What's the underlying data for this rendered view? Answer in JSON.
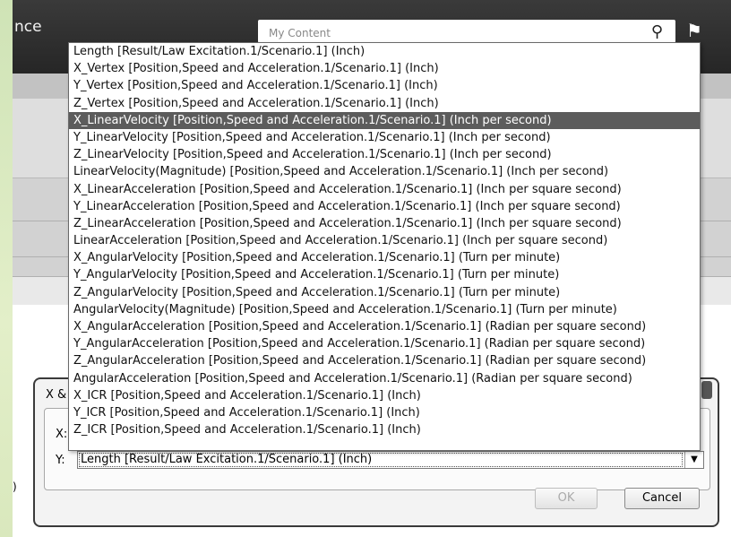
{
  "header": {
    "title_fragment": "nce",
    "search_placeholder": "My Content"
  },
  "dialog": {
    "title_fragment": "X &",
    "x_label": "X:",
    "y_label": "Y:",
    "y_value": "Length [Result/Law Excitation.1/Scenario.1] (Inch)",
    "ok_label": "OK",
    "cancel_label": "Cancel"
  },
  "background": {
    "paren": ")"
  },
  "dropdown": {
    "selected_index": 4,
    "options": [
      "Length [Result/Law Excitation.1/Scenario.1] (Inch)",
      "X_Vertex [Position,Speed and Acceleration.1/Scenario.1] (Inch)",
      "Y_Vertex [Position,Speed and Acceleration.1/Scenario.1] (Inch)",
      "Z_Vertex [Position,Speed and Acceleration.1/Scenario.1] (Inch)",
      "X_LinearVelocity [Position,Speed and Acceleration.1/Scenario.1] (Inch per second)",
      "Y_LinearVelocity [Position,Speed and Acceleration.1/Scenario.1] (Inch per second)",
      "Z_LinearVelocity [Position,Speed and Acceleration.1/Scenario.1] (Inch per second)",
      "LinearVelocity(Magnitude) [Position,Speed and Acceleration.1/Scenario.1] (Inch per second)",
      "X_LinearAcceleration [Position,Speed and Acceleration.1/Scenario.1] (Inch per square second)",
      "Y_LinearAcceleration [Position,Speed and Acceleration.1/Scenario.1] (Inch per square second)",
      "Z_LinearAcceleration [Position,Speed and Acceleration.1/Scenario.1] (Inch per square second)",
      "LinearAcceleration [Position,Speed and Acceleration.1/Scenario.1] (Inch per square second)",
      "X_AngularVelocity [Position,Speed and Acceleration.1/Scenario.1] (Turn per minute)",
      "Y_AngularVelocity [Position,Speed and Acceleration.1/Scenario.1] (Turn per minute)",
      "Z_AngularVelocity [Position,Speed and Acceleration.1/Scenario.1] (Turn per minute)",
      "AngularVelocity(Magnitude) [Position,Speed and Acceleration.1/Scenario.1] (Turn per minute)",
      "X_AngularAcceleration [Position,Speed and Acceleration.1/Scenario.1] (Radian per square second)",
      "Y_AngularAcceleration [Position,Speed and Acceleration.1/Scenario.1] (Radian per square second)",
      "Z_AngularAcceleration [Position,Speed and Acceleration.1/Scenario.1] (Radian per square second)",
      "AngularAcceleration [Position,Speed and Acceleration.1/Scenario.1] (Radian per square second)",
      "X_ICR [Position,Speed and Acceleration.1/Scenario.1] (Inch)",
      "Y_ICR [Position,Speed and Acceleration.1/Scenario.1] (Inch)",
      "Z_ICR [Position,Speed and Acceleration.1/Scenario.1] (Inch)"
    ]
  }
}
